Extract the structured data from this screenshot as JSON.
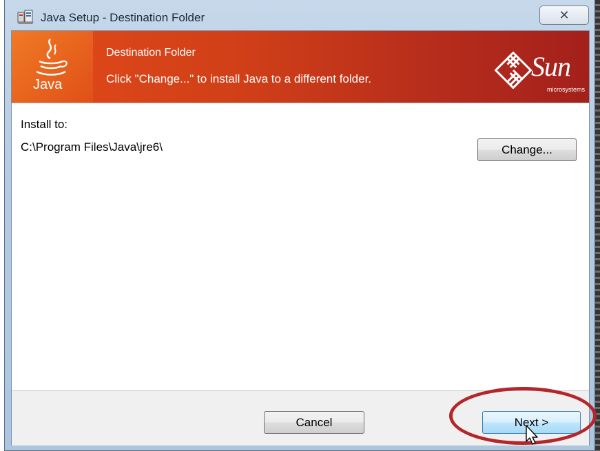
{
  "window": {
    "title": "Java Setup - Destination Folder",
    "close_glyph": "✕"
  },
  "banner": {
    "title": "Destination Folder",
    "subtitle": "Click \"Change...\" to install Java to a different folder.",
    "java_wordmark": "Java",
    "sun_wordmark": "Sun",
    "sun_microsystems": "microsystems"
  },
  "content": {
    "install_label": "Install to:",
    "install_path": "C:\\Program Files\\Java\\jre6\\",
    "change_label": "Change..."
  },
  "footer": {
    "cancel_label": "Cancel",
    "next_label": "Next >"
  },
  "colors": {
    "banner_orange": "#e24a1a",
    "banner_red": "#a3201b",
    "highlight_ring": "#b3262a",
    "window_frame": "#b4cbe2"
  },
  "icons": [
    "installer-icon",
    "close-icon",
    "java-logo-icon",
    "sun-logo-icon",
    "mouse-cursor-icon"
  ]
}
